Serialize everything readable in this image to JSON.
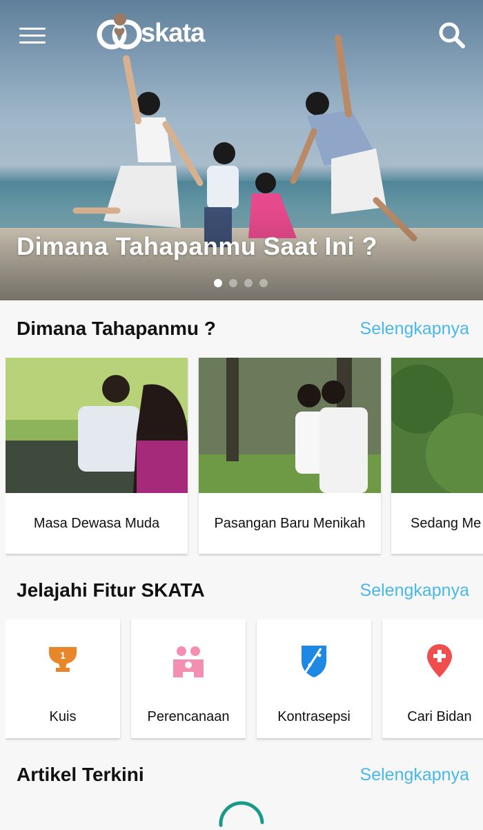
{
  "header": {
    "logo_text": "skata",
    "menu_icon": "hamburger-menu-icon",
    "search_icon": "search-icon"
  },
  "hero": {
    "title": "Dimana Tahapanmu Saat Ini ?",
    "slides": 4,
    "active_slide": 1
  },
  "stages": {
    "title": "Dimana Tahapanmu ?",
    "more": "Selengkapnya",
    "items": [
      {
        "label": "Masa Dewasa Muda"
      },
      {
        "label": "Pasangan Baru Menikah"
      },
      {
        "label": "Sedang Me"
      }
    ]
  },
  "features": {
    "title": "Jelajahi Fitur SKATA",
    "more": "Selengkapnya",
    "items": [
      {
        "label": "Kuis",
        "icon": "trophy-icon",
        "color": "#e8862a"
      },
      {
        "label": "Perencanaan",
        "icon": "family-icon",
        "color": "#f48fb1"
      },
      {
        "label": "Kontrasepsi",
        "icon": "shield-icon",
        "color": "#1e88e5"
      },
      {
        "label": "Cari Bidan",
        "icon": "location-pin-icon",
        "color": "#f04e4e"
      }
    ]
  },
  "articles": {
    "title": "Artikel Terkini",
    "more": "Selengkapnya"
  },
  "colors": {
    "accent_link": "#48b8e6",
    "spinner": "#19998a"
  }
}
